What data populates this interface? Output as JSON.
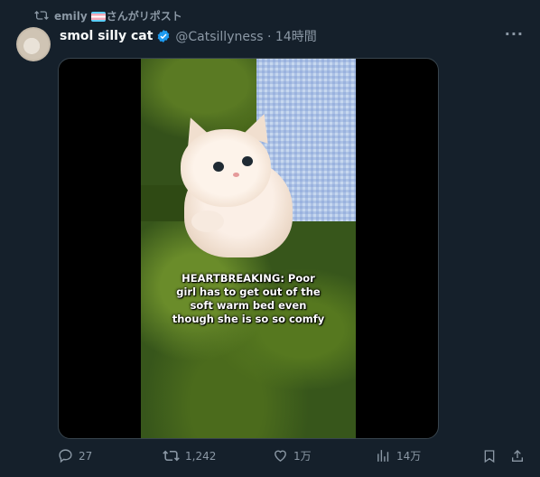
{
  "repost": {
    "name": "emily",
    "suffix": "さんがリポスト"
  },
  "post": {
    "display_name": "smol silly cat",
    "handle_time": "@Catsillyness · 14時間",
    "more_label": "···",
    "video_caption": [
      "HEARTBREAKING: Poor",
      "girl has to get out of the",
      "soft warm bed even",
      "though she is so so comfy"
    ]
  },
  "actions": {
    "replies": "27",
    "reposts": "1,242",
    "likes": "1万",
    "views": "14万"
  },
  "colors": {
    "background": "#15202b",
    "text_primary": "#f7f9f9",
    "text_secondary": "#8b98a5",
    "verified": "#1d9bf0",
    "border": "#38444d"
  },
  "icons": {
    "repost": "repost-icon",
    "verified": "verified-badge-icon",
    "more": "more-icon",
    "reply": "reply-icon",
    "like": "heart-icon",
    "views": "views-icon",
    "bookmark": "bookmark-icon",
    "share": "share-icon"
  }
}
